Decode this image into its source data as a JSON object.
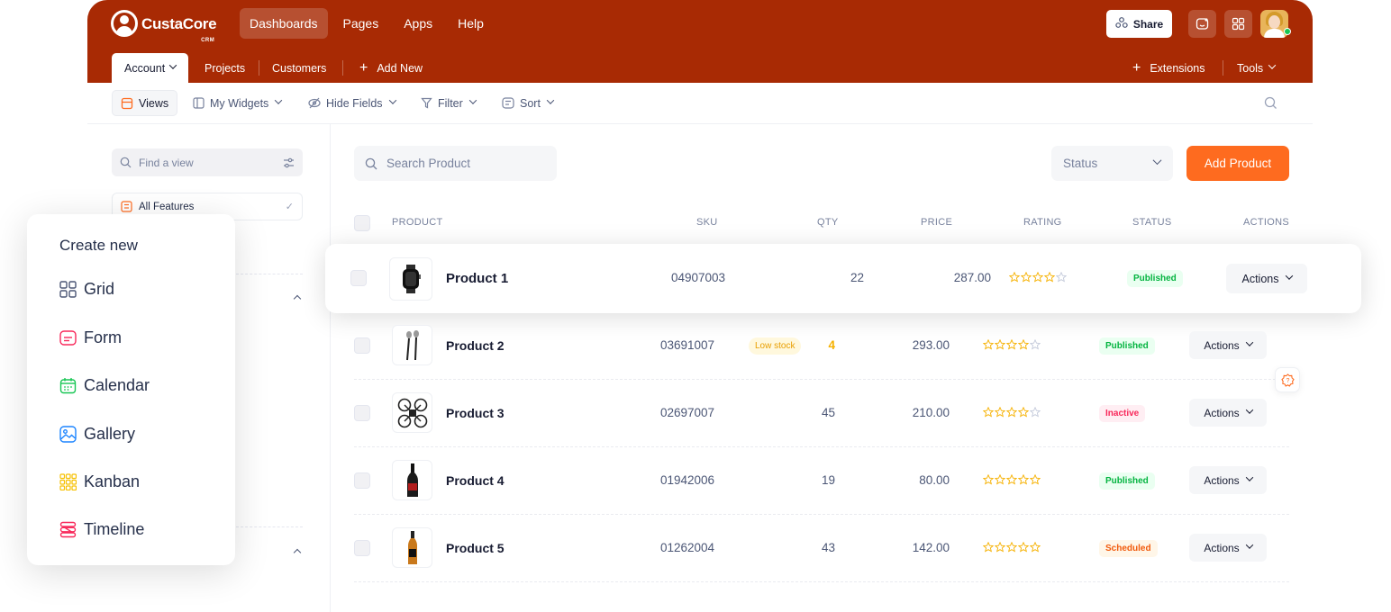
{
  "brand": {
    "name": "CustaCore",
    "sub": "CRM"
  },
  "main_nav": [
    "Dashboards",
    "Pages",
    "Apps",
    "Help"
  ],
  "header": {
    "share_label": "Share"
  },
  "sub_nav": {
    "account": "Account",
    "projects": "Projects",
    "customers": "Customers",
    "add_new": "Add New",
    "extensions": "Extensions",
    "tools": "Tools"
  },
  "toolbar": {
    "views": "Views",
    "widgets": "My Widgets",
    "hide_fields": "Hide Fields",
    "filter": "Filter",
    "sort": "Sort"
  },
  "sidebar": {
    "find_placeholder": "Find a view",
    "all_features": "All Features"
  },
  "popup": {
    "title": "Create new",
    "options": [
      {
        "label": "Grid",
        "icon": "grid-icon",
        "color": "#4b5675"
      },
      {
        "label": "Form",
        "icon": "form-icon",
        "color": "#f8285a"
      },
      {
        "label": "Calendar",
        "icon": "calendar-icon",
        "color": "#17c653"
      },
      {
        "label": "Gallery",
        "icon": "gallery-icon",
        "color": "#1b84ff"
      },
      {
        "label": "Kanban",
        "icon": "kanban-icon",
        "color": "#f6c000"
      },
      {
        "label": "Timeline",
        "icon": "timeline-icon",
        "color": "#f8285a"
      }
    ]
  },
  "product_toolbar": {
    "search_placeholder": "Search Product",
    "status_label": "Status",
    "add_label": "Add Product"
  },
  "table": {
    "headers": {
      "product": "PRODUCT",
      "sku": "SKU",
      "qty": "QTY",
      "price": "PRICE",
      "rating": "RATING",
      "status": "STATUS",
      "actions": "ACTIONS"
    },
    "actions_label": "Actions",
    "low_stock_label": "Low stock",
    "rows": [
      {
        "name": "Product 1",
        "sku": "04907003",
        "qty": "22",
        "price": "287.00",
        "rating": 4,
        "status": "Published",
        "status_kind": "published",
        "thumb": "watch"
      },
      {
        "name": "Product 2",
        "sku": "03691007",
        "qty": "4",
        "price": "293.00",
        "rating": 4,
        "status": "Published",
        "status_kind": "published",
        "thumb": "earbuds",
        "low_stock": true
      },
      {
        "name": "Product 3",
        "sku": "02697007",
        "qty": "45",
        "price": "210.00",
        "rating": 4,
        "status": "Inactive",
        "status_kind": "inactive",
        "thumb": "drone"
      },
      {
        "name": "Product 4",
        "sku": "01942006",
        "qty": "19",
        "price": "80.00",
        "rating": 5,
        "status": "Published",
        "status_kind": "published",
        "thumb": "wine"
      },
      {
        "name": "Product 5",
        "sku": "01262004",
        "qty": "43",
        "price": "142.00",
        "rating": 5,
        "status": "Scheduled",
        "status_kind": "scheduled",
        "thumb": "whiskey"
      }
    ]
  },
  "colors": {
    "header": "#a82a04",
    "accent": "#fe6b1f",
    "star": "#f6b100"
  }
}
